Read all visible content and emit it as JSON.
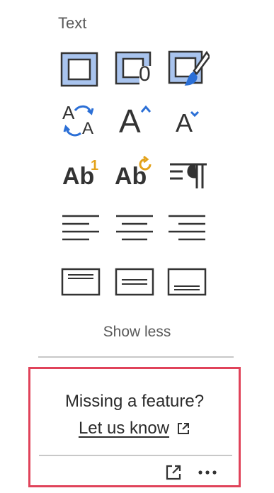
{
  "section": {
    "title": "Text"
  },
  "tools": {
    "change_case_a1": "A",
    "change_case_a2": "A",
    "grow_font": "A",
    "shrink_font": "A",
    "superscript_text": "Ab",
    "superscript_mark": "1",
    "clear_format_text": "Ab",
    "no_spacing_zero": "0"
  },
  "footer": {
    "show_less": "Show less",
    "missing_feature": "Missing a feature?",
    "let_us_know": "Let us know"
  },
  "colors": {
    "accent_blue": "#2b6fd6",
    "accent_fill": "#a9c4ee",
    "gold": "#e3a21a",
    "highlight_border": "#e0435a"
  }
}
